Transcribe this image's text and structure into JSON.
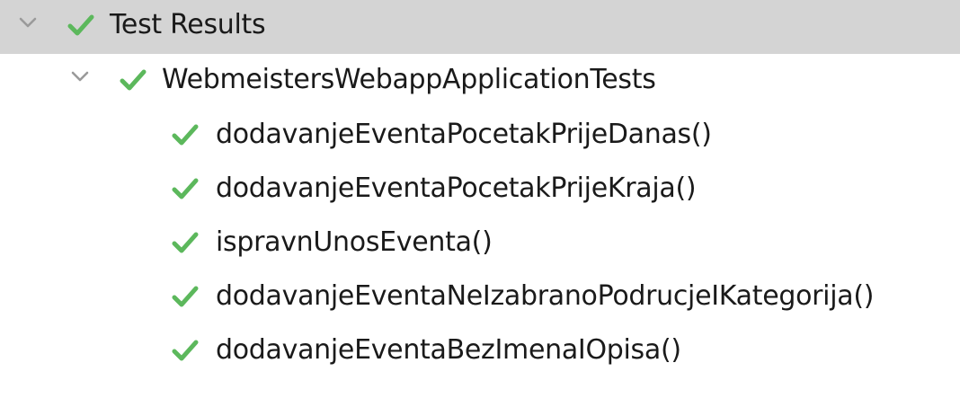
{
  "colors": {
    "check": "#5cb85c",
    "chevron": "#9a9a9a",
    "selected_bg": "#d4d4d4",
    "text": "#1a1a1a"
  },
  "icons": {
    "expand": "chevron-down-icon",
    "status": "checkmark-icon"
  },
  "tree": {
    "root": {
      "label": "Test Results",
      "status": "passed",
      "expanded": true,
      "selected": true
    },
    "suite": {
      "label": "WebmeistersWebappApplicationTests",
      "status": "passed",
      "expanded": true
    },
    "tests": [
      {
        "label": "dodavanjeEventaPocetakPrijeDanas()",
        "status": "passed"
      },
      {
        "label": "dodavanjeEventaPocetakPrijeKraja()",
        "status": "passed"
      },
      {
        "label": "ispravnUnosEventa()",
        "status": "passed"
      },
      {
        "label": "dodavanjeEventaNeIzabranoPodrucjeIKategorija()",
        "status": "passed"
      },
      {
        "label": "dodavanjeEventaBezImenaIOpisa()",
        "status": "passed"
      }
    ]
  }
}
